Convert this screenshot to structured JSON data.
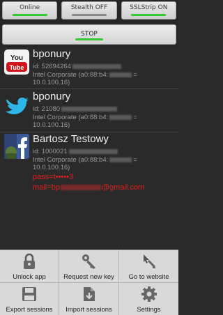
{
  "toggles": [
    {
      "label": "Online",
      "state": "on"
    },
    {
      "label": "Stealth OFF",
      "state": "off"
    },
    {
      "label": "SSLStrip ON",
      "state": "on"
    }
  ],
  "stop": {
    "label": "STOP"
  },
  "sessions": [
    {
      "service_icon": "youtube-icon",
      "name": "bponury",
      "id_line": "id: 52694264",
      "device_line": "Intel Corporate (a0:88:b4:",
      "device_suffix": "=",
      "ip_line": "10.0.100.16)"
    },
    {
      "service_icon": "twitter-icon",
      "name": "bponury",
      "id_line": "id: 21080",
      "device_line": "Intel Corporate (a0:88:b4:",
      "device_suffix": "=",
      "ip_line": "10.0.100.16)"
    },
    {
      "service_icon": "facebook-icon",
      "name": "Bartosz Testowy",
      "id_line": "id: 1000021",
      "device_line": "Intel Corporate (a0:88:b4:",
      "device_suffix": "=",
      "ip_line": "10.0.100.16)",
      "pass_line": "pass=t•••••3",
      "mail_line": "mail=bp",
      "mail_suffix": "@gmail.com"
    }
  ],
  "menu": [
    {
      "label": "Unlock app",
      "icon": "lock-icon"
    },
    {
      "label": "Request new key",
      "icon": "key-icon"
    },
    {
      "label": "Go to website",
      "icon": "cursor-arrow-icon"
    },
    {
      "label": "Export sessions",
      "icon": "save-icon"
    },
    {
      "label": "Import sessions",
      "icon": "import-icon"
    },
    {
      "label": "Settings",
      "icon": "gear-icon"
    }
  ],
  "colors": {
    "on": "#33c933",
    "off": "#8a8a8a",
    "accent_red": "#e42020"
  }
}
